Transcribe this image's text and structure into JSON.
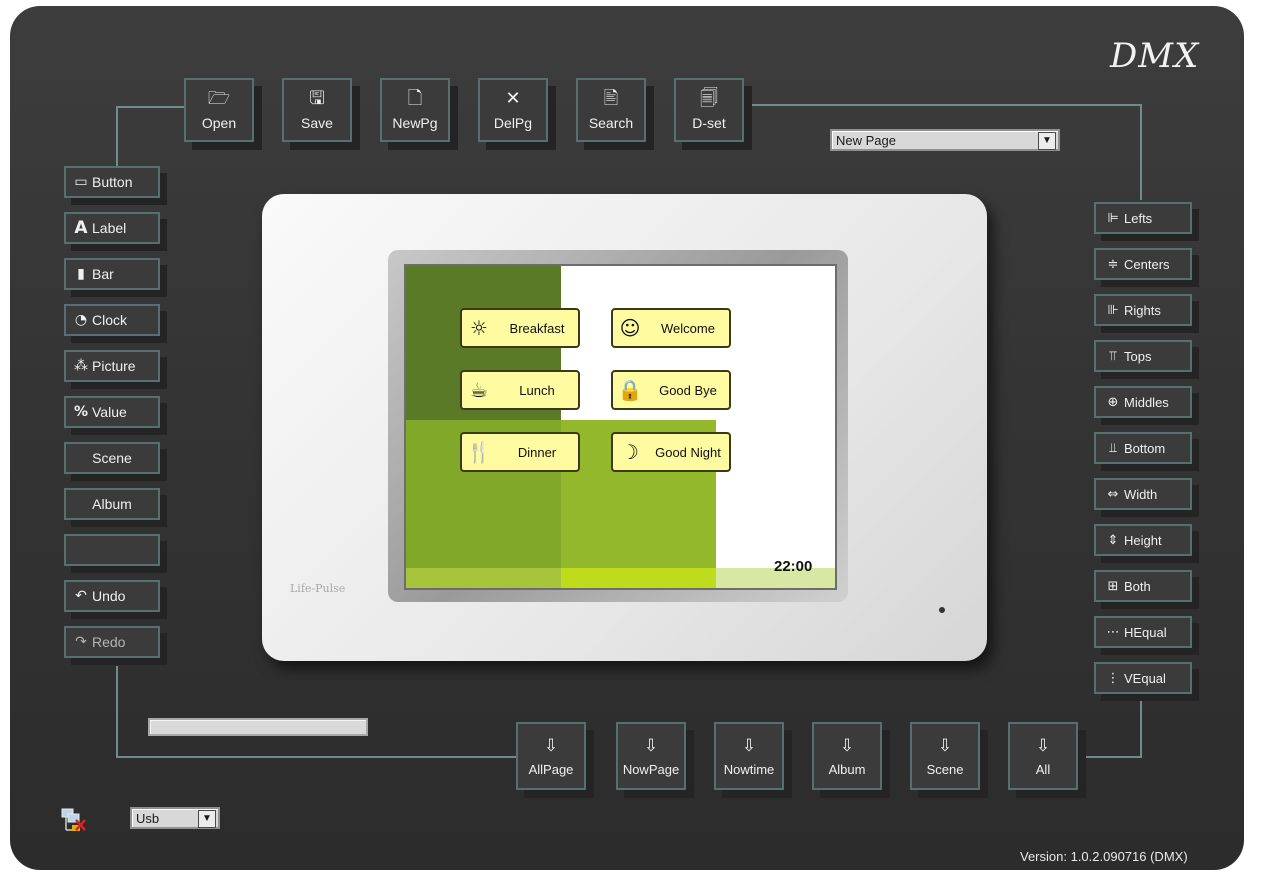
{
  "app": {
    "title": "DMX",
    "version": "Version: 1.0.2.090716 (DMX)"
  },
  "toolbar": [
    {
      "label": "Open",
      "icon": "open-folder-icon",
      "glyph": "🗁"
    },
    {
      "label": "Save",
      "icon": "save-icon",
      "glyph": "🖫"
    },
    {
      "label": "NewPg",
      "icon": "new-page-icon",
      "glyph": "🗋"
    },
    {
      "label": "DelPg",
      "icon": "delete-icon",
      "glyph": "✕"
    },
    {
      "label": "Search",
      "icon": "search-icon",
      "glyph": "🖹"
    },
    {
      "label": "D-set",
      "icon": "device-settings-icon",
      "glyph": "🗐"
    }
  ],
  "page_select": {
    "value": "New Page"
  },
  "left_tools": [
    {
      "label": "Button",
      "icon": "button-icon",
      "glyph": "▭"
    },
    {
      "label": "Label",
      "icon": "label-icon",
      "glyph": "A"
    },
    {
      "label": "Bar",
      "icon": "bar-icon",
      "glyph": "▮"
    },
    {
      "label": "Clock",
      "icon": "clock-icon",
      "glyph": "◔"
    },
    {
      "label": "Picture",
      "icon": "picture-icon",
      "glyph": "⁂"
    },
    {
      "label": "Value",
      "icon": "value-icon",
      "glyph": "%"
    },
    {
      "label": "Scene",
      "icon": "",
      "glyph": ""
    },
    {
      "label": "Album",
      "icon": "",
      "glyph": ""
    },
    {
      "label": "",
      "icon": "",
      "glyph": ""
    },
    {
      "label": "Undo",
      "icon": "undo-icon",
      "glyph": "↶"
    },
    {
      "label": "Redo",
      "icon": "redo-icon",
      "glyph": "↷"
    }
  ],
  "align_tools": [
    {
      "label": "Lefts",
      "icon": "align-lefts-icon",
      "glyph": "⊫"
    },
    {
      "label": "Centers",
      "icon": "align-centers-icon",
      "glyph": "≑"
    },
    {
      "label": "Rights",
      "icon": "align-rights-icon",
      "glyph": "⊪"
    },
    {
      "label": "Tops",
      "icon": "align-tops-icon",
      "glyph": "⫪"
    },
    {
      "label": "Middles",
      "icon": "align-middles-icon",
      "glyph": "⊕"
    },
    {
      "label": "Bottom",
      "icon": "align-bottom-icon",
      "glyph": "⫫"
    },
    {
      "label": "Width",
      "icon": "same-width-icon",
      "glyph": "⇔"
    },
    {
      "label": "Height",
      "icon": "same-height-icon",
      "glyph": "⇕"
    },
    {
      "label": "Both",
      "icon": "same-size-icon",
      "glyph": "⊞"
    },
    {
      "label": "HEqual",
      "icon": "horizontal-spacing-icon",
      "glyph": "⋯"
    },
    {
      "label": "VEqual",
      "icon": "vertical-spacing-icon",
      "glyph": "⋮"
    }
  ],
  "download": [
    {
      "label": "AllPage",
      "icon": "download-icon",
      "glyph": "⇩"
    },
    {
      "label": "NowPage",
      "icon": "download-icon",
      "glyph": "⇩"
    },
    {
      "label": "Nowtime",
      "icon": "download-icon",
      "glyph": "⇩"
    },
    {
      "label": "Album",
      "icon": "download-icon",
      "glyph": "⇩"
    },
    {
      "label": "Scene",
      "icon": "download-icon",
      "glyph": "⇩"
    },
    {
      "label": "All",
      "icon": "download-icon",
      "glyph": "⇩"
    }
  ],
  "port_select": {
    "value": "Usb"
  },
  "device": {
    "brand": "Life-Pulse",
    "time": "22:00",
    "buttons": [
      {
        "label": "Breakfast",
        "icon": "sun-icon",
        "glyph": "☼"
      },
      {
        "label": "Welcome",
        "icon": "smiley-icon",
        "glyph": "☺"
      },
      {
        "label": "Lunch",
        "icon": "cup-icon",
        "glyph": "☕"
      },
      {
        "label": "Good Bye",
        "icon": "lock-icon",
        "glyph": "🔒"
      },
      {
        "label": "Dinner",
        "icon": "fork-knife-icon",
        "glyph": "🍴"
      },
      {
        "label": "Good Night",
        "icon": "moon-icon",
        "glyph": "☽"
      }
    ],
    "colors": {
      "dark": "#5a7a27",
      "mid": "#82a82a",
      "light": "#94b82c",
      "lime": "#bedb1c",
      "pale": "#d8e8a4"
    }
  },
  "colors": {
    "panel": "#363636",
    "button_border": "#55706f",
    "connector": "#6f8c8b",
    "screen_button": "#fffba0"
  }
}
